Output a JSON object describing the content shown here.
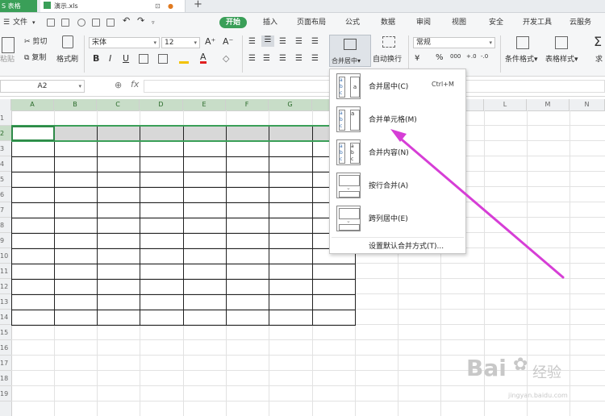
{
  "title_bar": {
    "app_tab": "S 表格",
    "file_tab": "演示.xls",
    "new_tab": "+"
  },
  "menu": {
    "file": "文件",
    "tabs": [
      "开始",
      "插入",
      "页面布局",
      "公式",
      "数据",
      "审阅",
      "视图",
      "安全",
      "开发工具",
      "云服务"
    ],
    "active": "开始"
  },
  "ribbon": {
    "paste": "粘贴",
    "cut": "剪切",
    "copy": "复制",
    "format_painter": "格式刷",
    "font_name": "宋体",
    "font_size": "12",
    "grow_font": "A⁺",
    "shrink_font": "A⁻",
    "bold": "B",
    "italic": "I",
    "underline": "U",
    "merge_center": "合并居中",
    "wrap_text": "自动换行",
    "number_format": "常规",
    "percent": "%",
    "thousands": "000",
    "cond_format": "条件格式",
    "table_style": "表格样式",
    "sum": "求"
  },
  "formula_bar": {
    "name_box": "A2",
    "fx": "fx",
    "value": ""
  },
  "sheet": {
    "columns": [
      "A",
      "B",
      "C",
      "D",
      "E",
      "F",
      "G",
      "H",
      "",
      "",
      "",
      "L",
      "M",
      "N"
    ],
    "rows": [
      "1",
      "2",
      "3",
      "4",
      "5",
      "6",
      "7",
      "8",
      "9",
      "10",
      "11",
      "12",
      "13",
      "14",
      "15",
      "16",
      "17",
      "18",
      "19"
    ],
    "selected_row": "2"
  },
  "dropdown": {
    "items": [
      {
        "label": "合并居中(C)",
        "shortcut": "Ctrl+M"
      },
      {
        "label": "合并单元格(M)",
        "shortcut": ""
      },
      {
        "label": "合并内容(N)",
        "shortcut": ""
      },
      {
        "label": "按行合并(A)",
        "shortcut": ""
      },
      {
        "label": "跨列居中(E)",
        "shortcut": ""
      }
    ],
    "footer": "设置默认合并方式(T)..."
  },
  "watermark": {
    "brand": "Bai",
    "brand2": "经验",
    "url": "jingyan.baidu.com"
  },
  "colors": {
    "accent": "#3a9f58",
    "arrow": "#d63ed6",
    "selection": "#c8ddc8"
  }
}
